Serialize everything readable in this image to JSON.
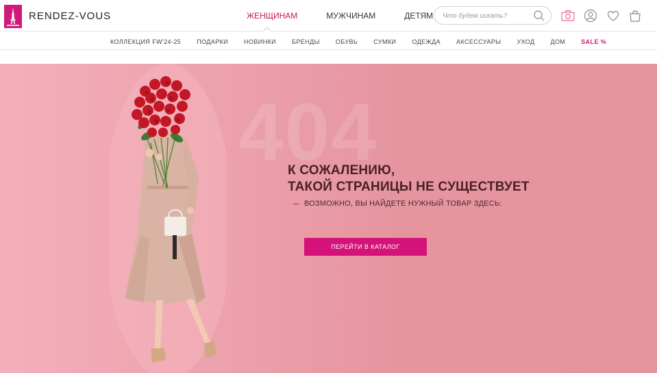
{
  "brand": {
    "name": "RENDEZ-VOUS",
    "accent": "#d0197a"
  },
  "main_nav": [
    {
      "label": "ЖЕНЩИНАМ",
      "active": true
    },
    {
      "label": "МУЖЧИНАМ",
      "active": false
    },
    {
      "label": "ДЕТЯМ",
      "active": false
    }
  ],
  "search": {
    "placeholder": "Что будем искать?"
  },
  "header_icons": [
    "camera-icon",
    "user-icon",
    "heart-icon",
    "bag-icon"
  ],
  "categories": [
    "КОЛЛЕКЦИЯ FW'24-25",
    "ПОДАРКИ",
    "НОВИНКИ",
    "БРЕНДЫ",
    "ОБУВЬ",
    "СУМКИ",
    "ОДЕЖДА",
    "АКСЕССУАРЫ",
    "УХОД",
    "ДОМ"
  ],
  "sale_label": "SALE %",
  "error": {
    "code": "404",
    "title_line1": "К СОЖАЛЕНИЮ,",
    "title_line2": "ТАКОЙ СТРАНИЦЫ НЕ СУЩЕСТВУЕТ",
    "hint": "ВОЗМОЖНО, ВЫ НАЙДЕТЕ НУЖНЫЙ ТОВАР ЗДЕСЬ:",
    "cta": "ПЕРЕЙТИ В КАТАЛОГ"
  },
  "colors": {
    "hero_bg": "#e8979f",
    "cta_bg": "#d5127a",
    "active_nav": "#c2185b"
  }
}
